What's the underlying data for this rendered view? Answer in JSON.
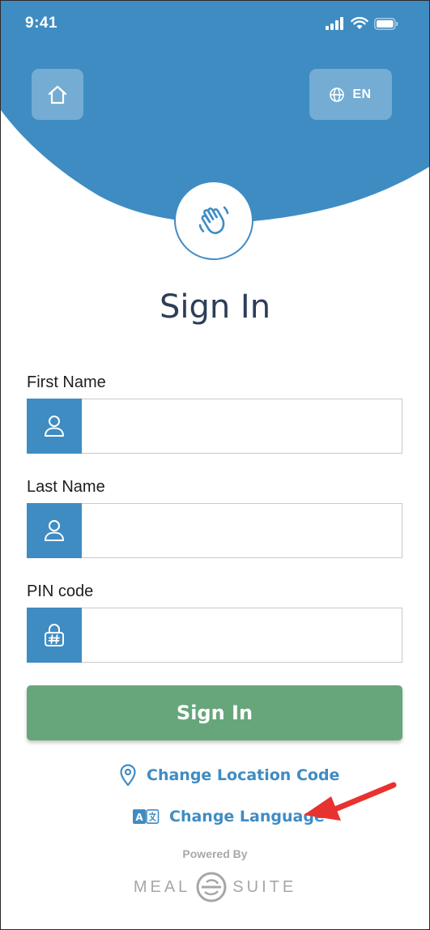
{
  "status_bar": {
    "time": "9:41"
  },
  "header": {
    "home_icon": "home-icon",
    "language_icon": "globe-icon",
    "language_code": "EN"
  },
  "hero": {
    "icon": "waving-hand-icon"
  },
  "title": "Sign In",
  "form": {
    "first_name": {
      "label": "First Name",
      "value": "",
      "icon": "user-icon"
    },
    "last_name": {
      "label": "Last Name",
      "value": "",
      "icon": "user-icon"
    },
    "pin_code": {
      "label": "PIN code",
      "value": "",
      "icon": "lock-hash-icon"
    },
    "submit_label": "Sign In"
  },
  "links": {
    "change_location": {
      "label": "Change Location Code",
      "icon": "location-pin-icon"
    },
    "change_language": {
      "label": "Change Language",
      "icon": "translate-icon"
    }
  },
  "footer": {
    "powered_by": "Powered By",
    "brand_left": "MEAL",
    "brand_right": "SUITE"
  },
  "colors": {
    "primary_blue": "#3f8cc3",
    "sign_in_green": "#67a67a",
    "title_navy": "#2c3e58",
    "annotation_red": "#e8322f"
  }
}
